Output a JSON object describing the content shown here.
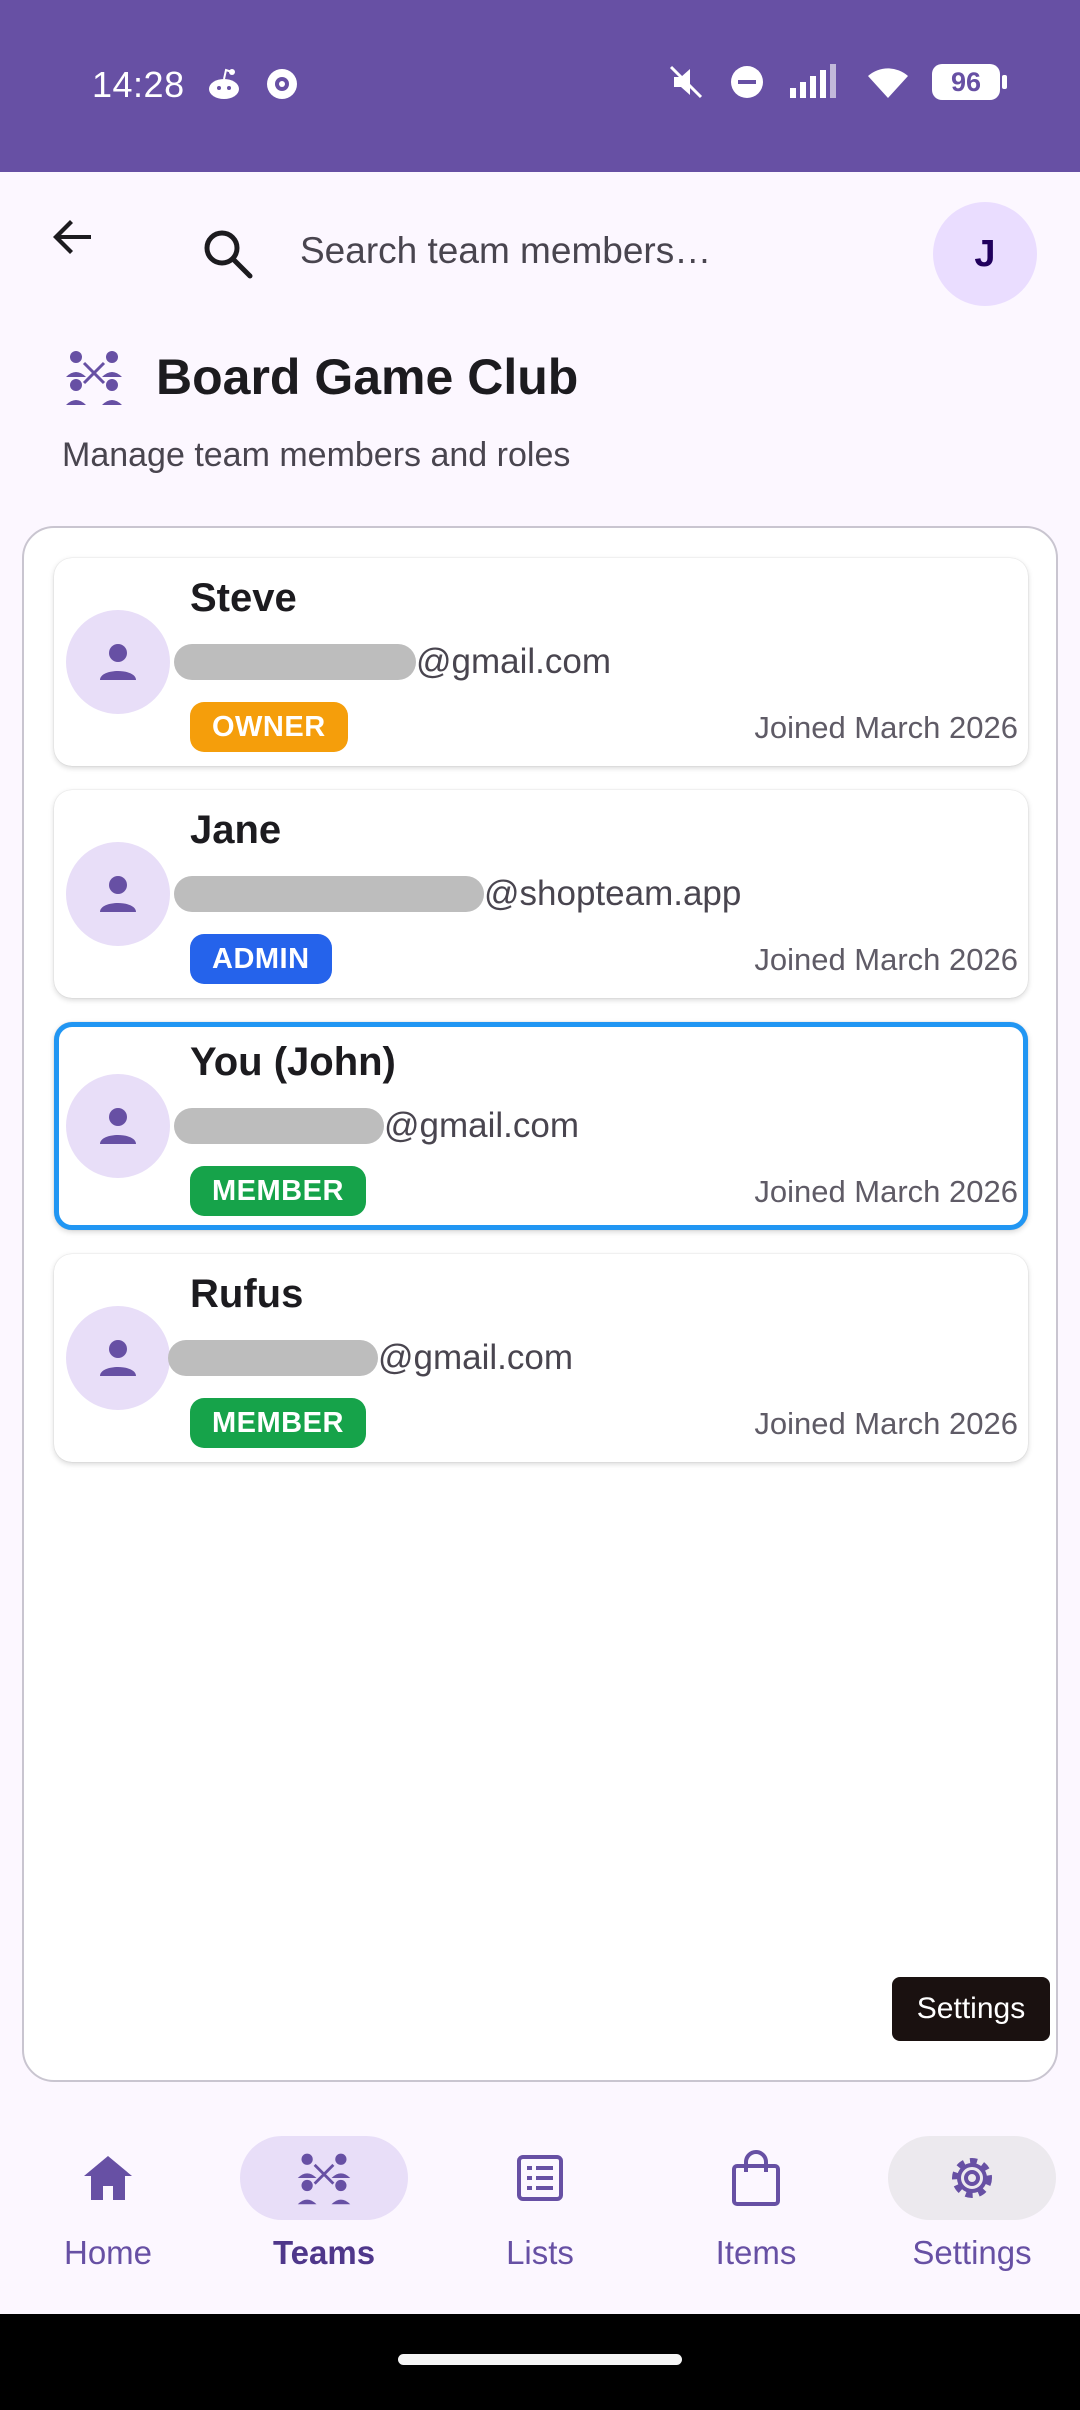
{
  "status_bar": {
    "time": "14:28",
    "battery": "96"
  },
  "search": {
    "placeholder": "Search team members…"
  },
  "user_avatar": {
    "initial": "J"
  },
  "team": {
    "name": "Board Game Club",
    "subtitle": "Manage team members and roles"
  },
  "members": [
    {
      "name": "Steve",
      "email_domain": "@gmail.com",
      "role": "OWNER",
      "role_color": "#f59e0b",
      "joined": "Joined March 2026"
    },
    {
      "name": "Jane",
      "email_domain": "@shopteam.app",
      "role": "ADMIN",
      "role_color": "#2563eb",
      "joined": "Joined March 2026"
    },
    {
      "name": "You (John)",
      "email_domain": "@gmail.com",
      "role": "MEMBER",
      "role_color": "#16a34a",
      "joined": "Joined March 2026",
      "current_user": true
    },
    {
      "name": "Rufus",
      "email_domain": "@gmail.com",
      "role": "MEMBER",
      "role_color": "#16a34a",
      "joined": "Joined March 2026"
    }
  ],
  "tooltip": {
    "text": "Settings"
  },
  "nav": {
    "items": [
      {
        "label": "Home",
        "icon": "home-icon"
      },
      {
        "label": "Teams",
        "icon": "teams-icon",
        "active": true
      },
      {
        "label": "Lists",
        "icon": "list-icon"
      },
      {
        "label": "Items",
        "icon": "shopping-bag-icon"
      },
      {
        "label": "Settings",
        "icon": "gear-icon"
      }
    ]
  },
  "colors": {
    "primary": "#6750a4",
    "primary_container": "#e8def8",
    "current_user_border": "#2196f3"
  }
}
